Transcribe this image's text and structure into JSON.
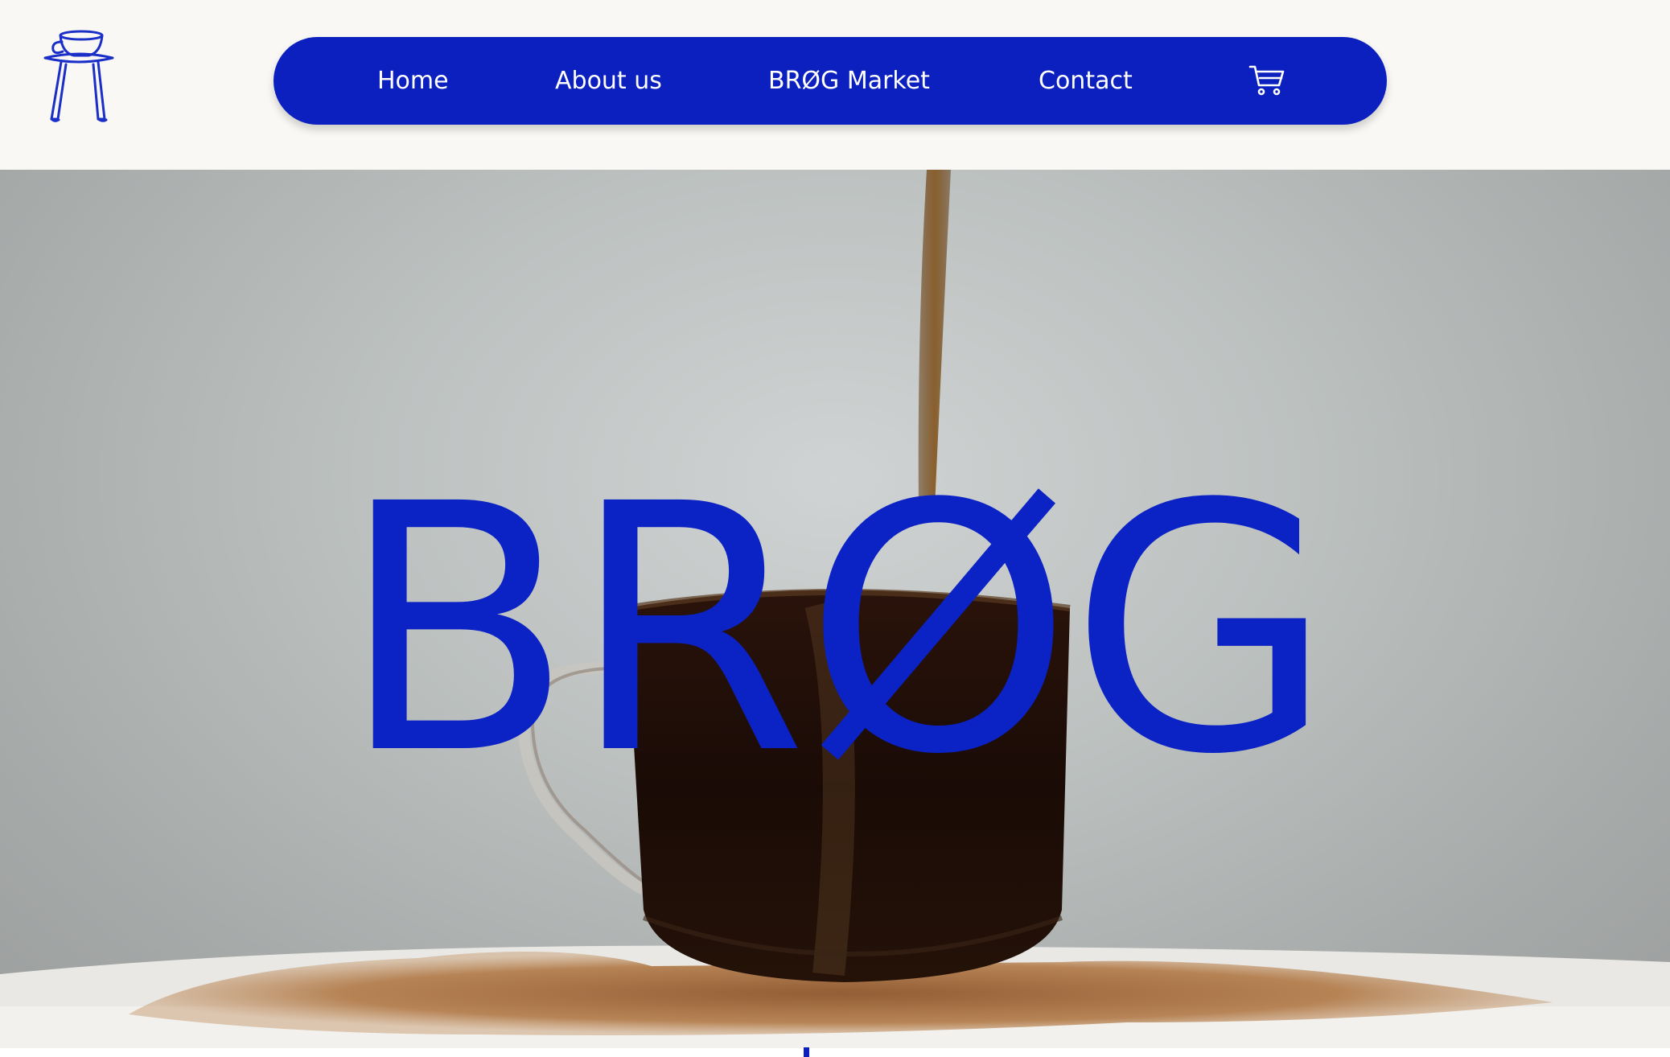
{
  "brand": {
    "logo_icon": "cup-on-legs-logo-icon",
    "hero_title": "BRØG",
    "accent_color": "#0b20bf"
  },
  "nav": {
    "items": [
      {
        "label": "Home"
      },
      {
        "label": "About us"
      },
      {
        "label": "BRØG Market"
      },
      {
        "label": "Contact"
      }
    ],
    "cart_icon": "shopping-cart-icon"
  }
}
